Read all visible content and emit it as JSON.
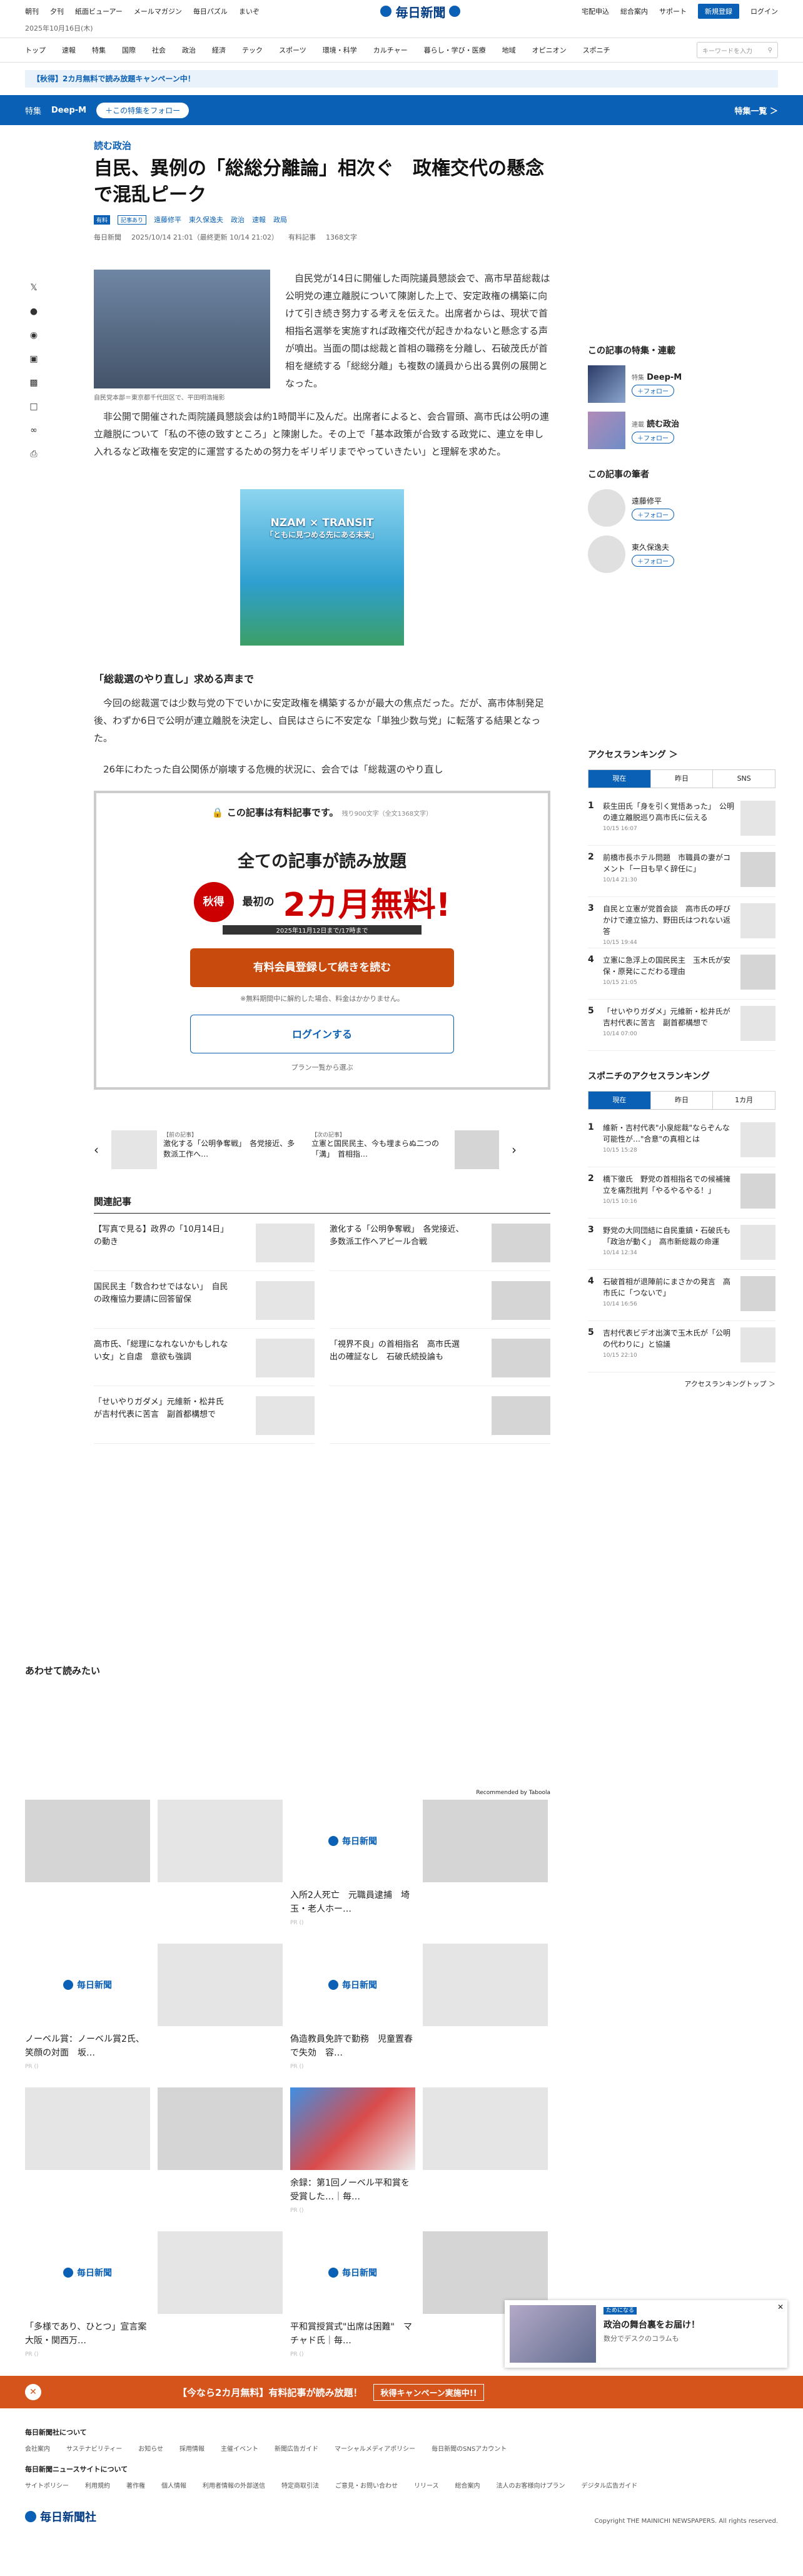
{
  "header": {
    "left_links": [
      "朝刊",
      "夕刊",
      "紙面ビューアー",
      "メールマガジン",
      "毎日パズル",
      "まいぞ"
    ],
    "logo_text": "毎日新聞",
    "right_links": [
      "宅配申込",
      "総合案内",
      "サポート"
    ],
    "register": "新規登録",
    "login": "ログイン",
    "date": "2025年10月16日(木)"
  },
  "nav": {
    "items": [
      "トップ",
      "速報",
      "特集",
      "国際",
      "社会",
      "政治",
      "経済",
      "テック",
      "スポーツ",
      "環境・科学",
      "カルチャー",
      "暮らし・学び・医療",
      "地域",
      "オピニオン",
      "スポニチ"
    ],
    "search_placeholder": "キーワードを入力"
  },
  "promo": "【秋得】2カ月無料で読み放題キャンペーン中！",
  "band": {
    "label": "特集",
    "series": "Deep-M",
    "follow": "＋この特集をフォロー",
    "list": "特集一覧 ＞"
  },
  "article": {
    "category": "読む政治",
    "title": "自民、異例の「総総分離論」相次ぐ　政権交代の懸念で混乱ピーク",
    "tag1": "有料",
    "tag2": "記事あり",
    "authors": [
      "遠藤修平",
      "東久保逸夫"
    ],
    "topics": [
      "政治",
      "速報",
      "政局"
    ],
    "meta": [
      "毎日新聞",
      "2025/10/14 21:01（最終更新 10/14 21:02）",
      "有料記事",
      "1368文字"
    ],
    "caption": "自民党本部＝東京都千代田区で、平田明浩撮影",
    "p1": "自民党が14日に開催した両院議員懇談会で、高市早苗総裁は公明党の連立離脱について陳謝した上で、安定政権の構築に向けて引き続き努力する考えを伝えた。出席者からは、現状で首相指名選挙を実施すれば政権交代が起きかねないと懸念する声が噴出。当面の間は総裁と首相の職務を分離し、石破茂氏が首相を継続する「総総分離」も複数の議員から出る異例の展開となった。",
    "p2": "非公開で開催された両院議員懇談会は約1時間半に及んだ。出席者によると、会合冒頭、高市氏は公明の連立離脱について「私の不徳の致すところ」と陳謝した。その上で「基本政策が合致する政党に、連立を申し入れるなど政権を安定的に運営するための努力をギリギリまでやっていきたい」と理解を求めた。",
    "ad_text": "NZAM × TRANSIT",
    "ad_sub": "「ともに見つめる先にある未来」",
    "h3": "「総裁選のやり直し」求める声まで",
    "p3": "今回の総裁選では少数与党の下でいかに安定政権を構築するかが最大の焦点だった。だが、高市体制発足後、わずか6日で公明が連立離脱を決定し、自民はさらに不安定な「単独少数与党」に転落する結果となった。",
    "p4": "26年にわたった自公関係が崩壊する危機的状況に、会合では「総裁選のやり直し"
  },
  "paywall": {
    "title": "この記事は有料記事です。",
    "remaining": "残り900文字（全文1368文字）",
    "headline": "全ての記事が読み放題",
    "badge": "秋得",
    "pre": "最初の",
    "free": "2カ月無料!",
    "period": "2025年11月12日まで/17時まで",
    "register": "有料会員登録して続きを読む",
    "note": "※無料期間中に解約した場合、料金はかかりません。",
    "login": "ログインする",
    "plans": "プラン一覧から選ぶ"
  },
  "carousel": [
    {
      "head": "【前の記事】",
      "title": "激化する「公明争奪戦」　各党接近、多数派工作へ…"
    },
    {
      "head": "【次の記事】",
      "title": "立憲と国民民主、今も埋まらぬ二つの「溝」　首相指…"
    }
  ],
  "related": {
    "heading": "関連記事",
    "items": [
      "【写真で見る】政界の「10月14日」の動き",
      "激化する「公明争奪戦」　各党接近、多数派工作へアピール合戦",
      "国民民主「数合わせではない」　自民の政権協力要請に回答留保",
      "",
      "高市氏、「総理になれないかもしれない女」と自虐　意欲も強調",
      "「視界不良」の首相指名　高市氏選出の確証なし　石破氏続投論も",
      "「せいやりガダメ」元維新・松井氏が吉村代表に苦言　副首都構想で",
      ""
    ]
  },
  "recommended": {
    "heading": "あわせて読みたい",
    "by": "Recommended by Taboola",
    "pr": "PR ()",
    "cards": [
      {
        "title": "",
        "logo": false
      },
      {
        "title": "",
        "logo": false
      },
      {
        "title": "入所2人死亡　元職員逮捕　埼玉・老人ホー…",
        "logo": true
      },
      {
        "title": "",
        "logo": false
      },
      {
        "title": "ノーベル賞：ノーベル賞2氏、笑顔の対面　坂…",
        "logo": true
      },
      {
        "title": "",
        "logo": false
      },
      {
        "title": "偽造教員免許で勤務　児童置春で失効　容…",
        "logo": true
      },
      {
        "title": "",
        "logo": false
      },
      {
        "title": "",
        "logo": false
      },
      {
        "title": "",
        "logo": false
      },
      {
        "title": "余録：第1回ノーベル平和賞を受賞した…｜毎…",
        "logo": false
      },
      {
        "title": "",
        "logo": false
      },
      {
        "title": "「多様であり、ひとつ」宣言案　大阪・関西万…",
        "logo": true
      },
      {
        "title": "",
        "logo": false
      },
      {
        "title": "平和賞授賞式\"出席は困難\"　マチャド氏｜毎…",
        "logo": true
      },
      {
        "title": "",
        "logo": false
      }
    ]
  },
  "sidebar": {
    "feature_heading": "この記事の特集・連載",
    "features": [
      {
        "kind": "特集",
        "name": "Deep-M"
      },
      {
        "kind": "連載",
        "name": "読む政治"
      }
    ],
    "follow": "＋フォロー",
    "author_heading": "この記事の筆者",
    "authors": [
      "遠藤修平",
      "東久保逸夫"
    ],
    "ranking_heading": "アクセスランキング ＞",
    "tabs": [
      "現在",
      "昨日",
      "SNS"
    ],
    "ranking": [
      {
        "n": "1",
        "t": "萩生田氏「身を引く覚悟あった」　公明の連立離脱巡り高市氏に伝える",
        "d": "10/15 16:07"
      },
      {
        "n": "2",
        "t": "前橋市長ホテル問題　市職員の妻がコメント「一日も早く辞任に」",
        "d": "10/14 21:30"
      },
      {
        "n": "3",
        "t": "自民と立憲が党首会談　高市氏の呼びかけで連立協力、野田氏はつれない返答",
        "d": "10/15 19:44"
      },
      {
        "n": "4",
        "t": "立憲に急浮上の国民民主　玉木氏が安保・原発にこだわる理由",
        "d": "10/15 21:05"
      },
      {
        "n": "5",
        "t": "「せいやりガダメ」元維新・松井氏が吉村代表に苦言　副首都構想で",
        "d": "10/14 07:00"
      }
    ],
    "sponichi_heading": "スポニチのアクセスランキング",
    "sp_tabs": [
      "現在",
      "昨日",
      "1カ月"
    ],
    "sponichi": [
      {
        "n": "1",
        "t": "維新・吉村代表\"小泉総裁\"ならぞんな可能性が…\"合意\"の真相とは",
        "d": "10/15 15:28"
      },
      {
        "n": "2",
        "t": "橋下徹氏　野党の首相指名での候補擁立を痛烈批判「やるやるやる！」",
        "d": "10/15 10:16"
      },
      {
        "n": "3",
        "t": "野党の大同団結に自民重鎮・石破氏も「政治が動く」　高市新総裁の命運",
        "d": "10/14 12:34"
      },
      {
        "n": "4",
        "t": "石破首相が退陣前にまさかの発言　高市氏に「つないで」",
        "d": "10/14 16:56"
      },
      {
        "n": "5",
        "t": "吉村代表ビデオ出演で玉木氏が「公明の代わりに」と協議",
        "d": "10/15 22:10"
      }
    ],
    "more": "アクセスランキングトップ ＞"
  },
  "popup": {
    "label": "ためになる",
    "title": "政治の舞台裏をお届け！",
    "sub": "数分でデスクのコラムも"
  },
  "bottom_band": {
    "text": "【今なら2カ月無料】有料記事が読み放題！",
    "cta": "秋得キャンペーン実施中!!"
  },
  "footer": {
    "h1": "毎日新聞社について",
    "links1": [
      "会社案内",
      "サステナビリティー",
      "お知らせ",
      "採用情報",
      "主催イベント",
      "新聞広告ガイド",
      "マーシャルメディアポリシー",
      "毎日新聞のSNSアカウント"
    ],
    "h2": "毎日新聞ニュースサイトについて",
    "links2": [
      "サイトポリシー",
      "利用規約",
      "著作権",
      "個人情報",
      "利用者情報の外部送信",
      "特定商取引法",
      "ご意見・お問い合わせ",
      "リリース",
      "総合案内",
      "法人のお客様向けプラン",
      "デジタル広告ガイド"
    ],
    "company": "毎日新聞社",
    "copyright": "Copyright THE MAINICHI NEWSPAPERS. All rights reserved."
  }
}
